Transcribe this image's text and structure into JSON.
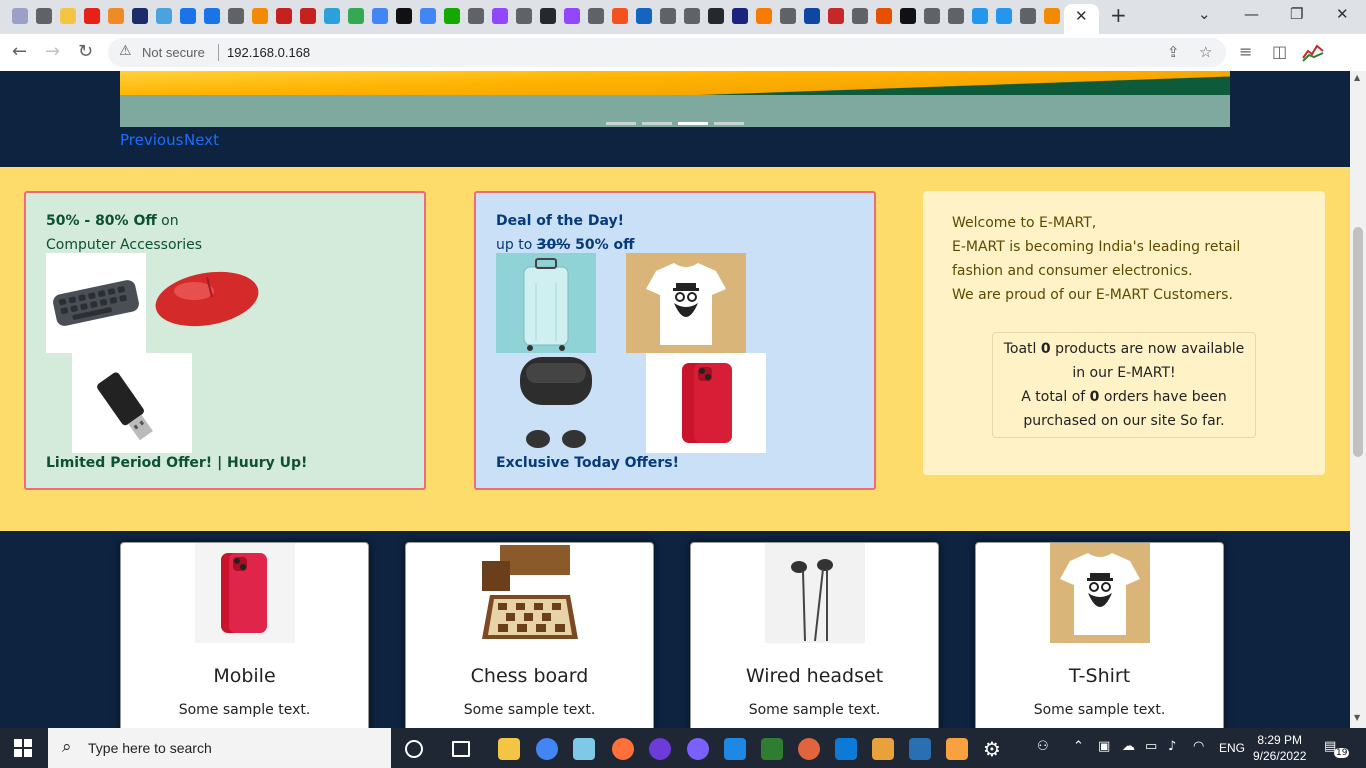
{
  "browser": {
    "tab_close": "✕",
    "new_tab": "+",
    "not_secure": "Not secure",
    "url": "192.168.0.168",
    "window_controls": {
      "minimize": "—",
      "maximize": "❐",
      "close": "✕",
      "tab_list": "⌄"
    }
  },
  "carousel": {
    "prev_label": "Previous",
    "next_label": "Next",
    "active_slide": 3,
    "slide_count": 4
  },
  "offer_left": {
    "discount": "50% - 80% Off",
    "on_word": "on",
    "category": "Computer Accessories",
    "footer": "Limited Period Offer! | Huury Up!"
  },
  "offer_right": {
    "title": "Deal of the Day!",
    "up_to": "up to",
    "old_discount": "30%",
    "new_discount": "50% off",
    "footer": "Exclusive Today Offers!"
  },
  "welcome": {
    "line1": "Welcome to E-MART,",
    "line2": "E-MART is becoming India's leading retail",
    "line3": "fashion and consumer electronics.",
    "line4": "We are proud of our E-MART Customers.",
    "stats_a": "Toatl",
    "product_count": "0",
    "stats_b": "products are now available",
    "stats_c": "in our E-MART!",
    "stats_d": "A total of",
    "order_count": "0",
    "stats_e": "orders have been",
    "stats_f": "purchased on our site So far."
  },
  "products": [
    {
      "title": "Mobile",
      "text": "Some sample text."
    },
    {
      "title": "Chess board",
      "text": "Some sample text."
    },
    {
      "title": "Wired headset",
      "text": "Some sample text."
    },
    {
      "title": "T-Shirt",
      "text": "Some sample text."
    }
  ],
  "taskbar": {
    "search_placeholder": "Type here to search",
    "lang": "ENG",
    "time": "8:29 PM",
    "date": "9/26/2022",
    "notifications": "19"
  }
}
